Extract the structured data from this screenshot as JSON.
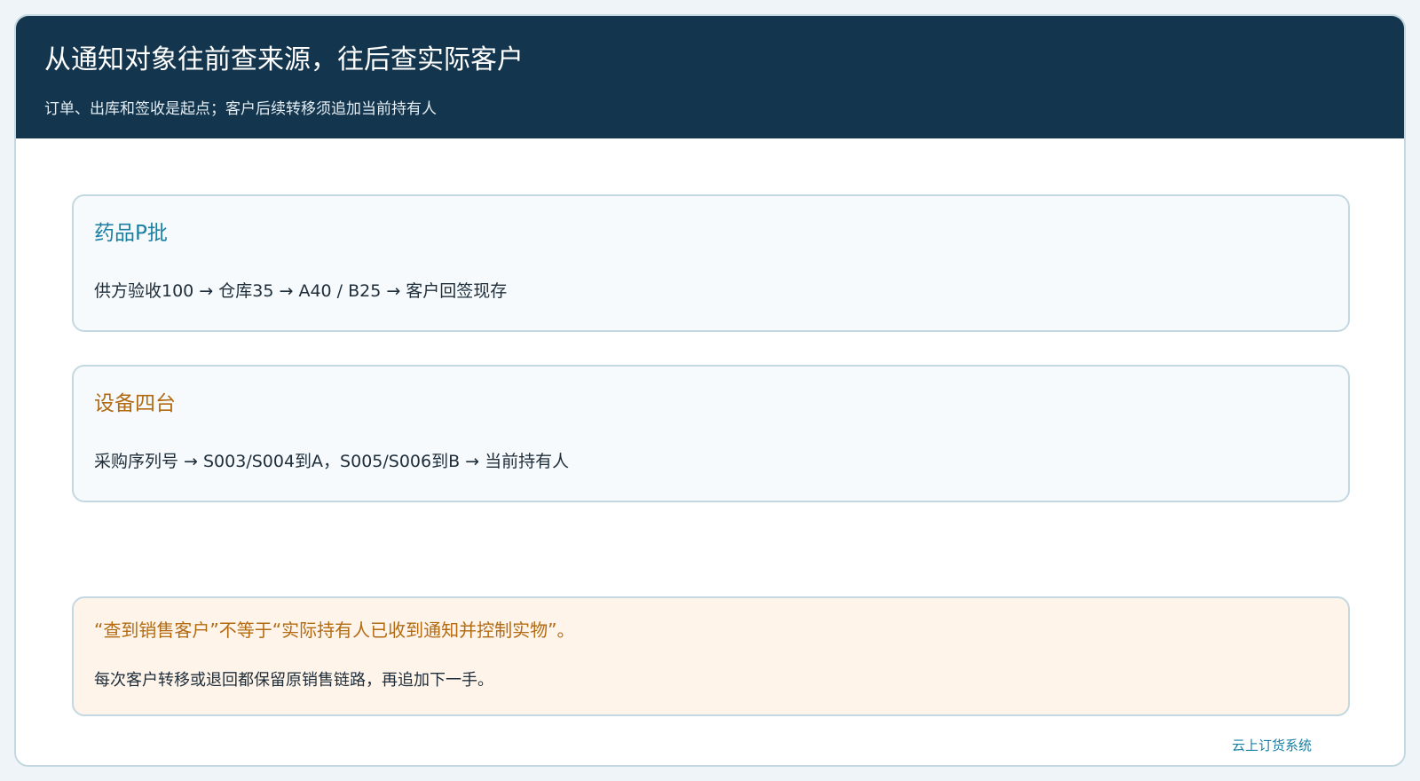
{
  "header": {
    "title": "从通知对象往前查来源，往后查实际客户",
    "subtitle": "订单、出库和签收是起点；客户后续转移须追加当前持有人"
  },
  "cards": [
    {
      "title": "药品P批",
      "body": "供方验收100 → 仓库35 → A40 / B25 → 客户回签现存",
      "accent": "#1a7fa3"
    },
    {
      "title": "设备四台",
      "body": "采购序列号 → S003/S004到A，S005/S006到B → 当前持有人",
      "accent": "#b26b12"
    }
  ],
  "note": {
    "title": "“查到销售客户”不等于“实际持有人已收到通知并控制实物”。",
    "body": "每次客户转移或退回都保留原销售链路，再追加下一手。",
    "accent": "#b26b12"
  },
  "footer": {
    "label": "云上订货系统"
  }
}
